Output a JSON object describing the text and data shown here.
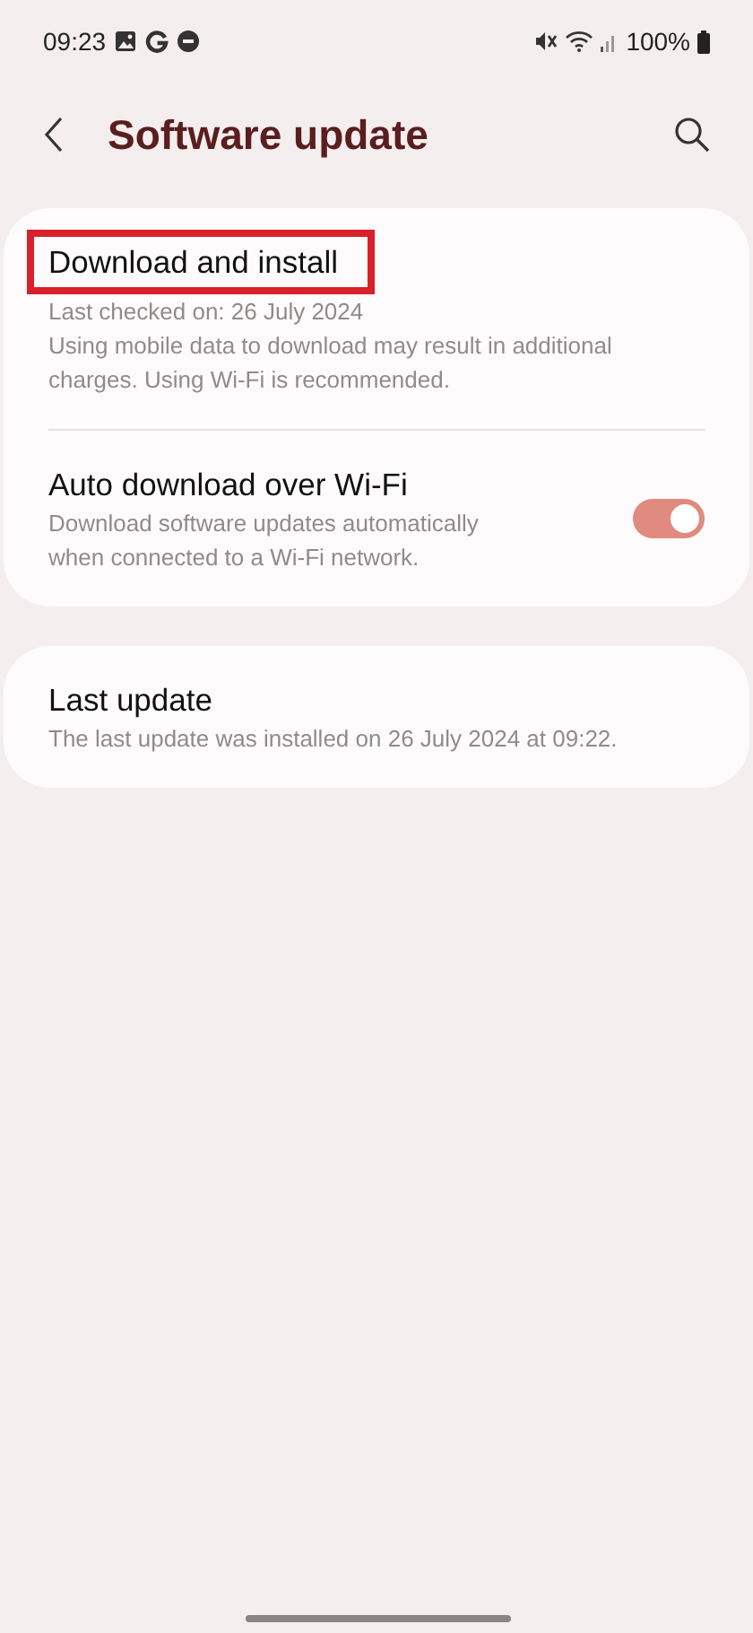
{
  "status_bar": {
    "time": "09:23",
    "battery": "100%"
  },
  "header": {
    "title": "Software update"
  },
  "groups": [
    {
      "items": [
        {
          "kind": "text",
          "title": "Download and install",
          "highlighted": true,
          "lines": [
            "Last checked on: 26 July 2024",
            "Using mobile data to download may result in additional charges. Using Wi-Fi is recommended."
          ]
        },
        {
          "kind": "toggle",
          "title": "Auto download over Wi-Fi",
          "on": true,
          "lines": [
            "Download software updates automatically when connected to a Wi-Fi network."
          ]
        }
      ]
    },
    {
      "items": [
        {
          "kind": "text",
          "title": "Last update",
          "highlighted": false,
          "lines": [
            "The last update was installed on 26 July 2024 at 09:22."
          ]
        }
      ]
    }
  ]
}
